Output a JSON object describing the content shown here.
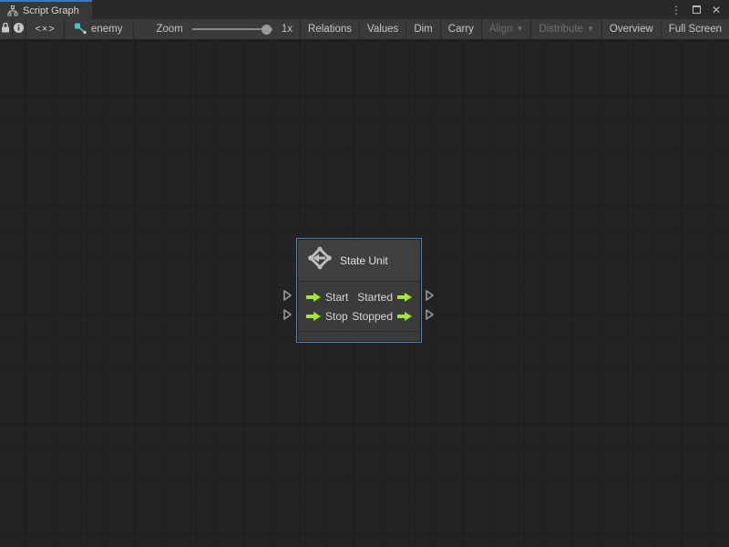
{
  "window": {
    "tab_title": "Script Graph",
    "controls": {
      "menu_glyph": "⋮",
      "close_glyph": "✕"
    }
  },
  "toolbar": {
    "code_toggle_glyph": "<×>",
    "graph_name": "enemy",
    "zoom": {
      "label": "Zoom",
      "value": "1x",
      "percent": 93
    },
    "buttons": [
      {
        "label": "Relations",
        "disabled": false,
        "dropdown": false
      },
      {
        "label": "Values",
        "disabled": false,
        "dropdown": false
      },
      {
        "label": "Dim",
        "disabled": false,
        "dropdown": false
      },
      {
        "label": "Carry",
        "disabled": false,
        "dropdown": false
      },
      {
        "label": "Align",
        "disabled": true,
        "dropdown": true
      },
      {
        "label": "Distribute",
        "disabled": true,
        "dropdown": true
      },
      {
        "label": "Overview",
        "disabled": false,
        "dropdown": false
      },
      {
        "label": "Full Screen",
        "disabled": false,
        "dropdown": false
      }
    ]
  },
  "node": {
    "title": "State Unit",
    "rows": [
      {
        "input": "Start",
        "output": "Started"
      },
      {
        "input": "Stop",
        "output": "Stopped"
      }
    ]
  },
  "colors": {
    "tab_accent_blue": "#3e7bb6",
    "selection_border": "#4a84bc",
    "port_arrow_green": "#a0e63c",
    "graph_icon_teal": "#4fc4b7"
  }
}
